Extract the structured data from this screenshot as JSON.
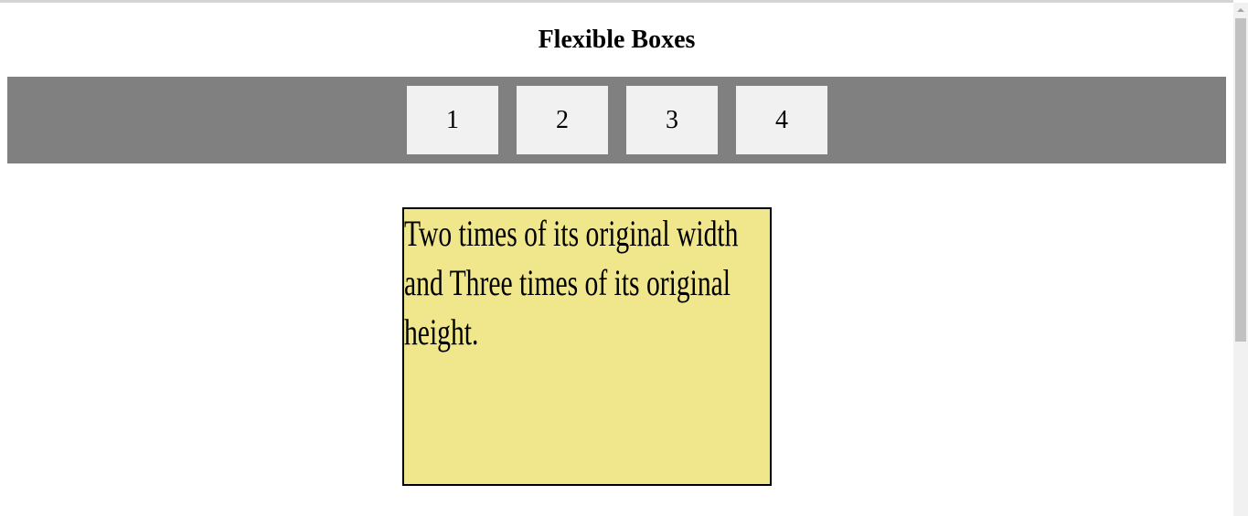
{
  "heading": "Flexible Boxes",
  "flex_items": [
    "1",
    "2",
    "3",
    "4"
  ],
  "resized_box": {
    "text": "Two times of its original width and Three times of its original height."
  },
  "colors": {
    "container_bg": "#808080",
    "item_bg": "#f1f1f1",
    "resized_bg": "#f0e68c"
  },
  "icons": {
    "scroll_up": "chevron-up-icon"
  }
}
